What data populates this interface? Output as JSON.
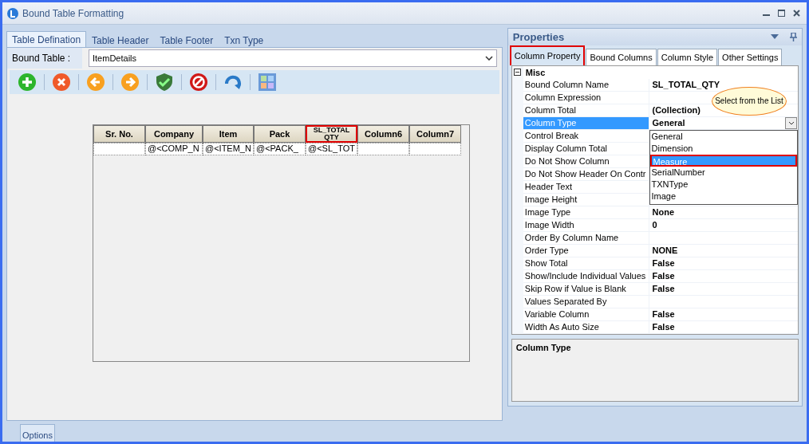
{
  "window": {
    "title": "Bound Table Formatting"
  },
  "tabs": [
    {
      "label": "Table Defination",
      "selected": true
    },
    {
      "label": "Table Header",
      "selected": false
    },
    {
      "label": "Table Footer",
      "selected": false
    },
    {
      "label": "Txn Type",
      "selected": false
    }
  ],
  "bound_table": {
    "label": "Bound Table :",
    "value": "ItemDetails"
  },
  "toolbar": [
    {
      "kind": "add"
    },
    {
      "kind": "delete"
    },
    {
      "kind": "back"
    },
    {
      "kind": "forward"
    },
    {
      "kind": "verify"
    },
    {
      "kind": "stop"
    },
    {
      "kind": "refresh"
    },
    {
      "kind": "layout"
    }
  ],
  "table": {
    "columns": [
      {
        "label": "Sr. No.",
        "highlighted": false
      },
      {
        "label": "Company",
        "highlighted": false
      },
      {
        "label": "Item",
        "highlighted": false
      },
      {
        "label": "Pack",
        "highlighted": false
      },
      {
        "label": "SL_TOTAL QTY",
        "highlighted": true
      },
      {
        "label": "Column6",
        "highlighted": false
      },
      {
        "label": "Column7",
        "highlighted": false
      }
    ],
    "rows": [
      [
        "",
        "@<COMP_N",
        "@<ITEM_N",
        "@<PACK_",
        "@<SL_TOT",
        "",
        ""
      ]
    ]
  },
  "properties": {
    "title": "Properties",
    "tabs": [
      {
        "label": "Column Property",
        "selected": true,
        "highlighted": true
      },
      {
        "label": "Bound Columns",
        "selected": false,
        "highlighted": false
      },
      {
        "label": "Column Style",
        "selected": false,
        "highlighted": false
      },
      {
        "label": "Other Settings",
        "selected": false,
        "highlighted": false
      }
    ],
    "category": {
      "label": "Misc",
      "expanded": true
    },
    "rows": [
      {
        "name": "Bound Column Name",
        "value": "SL_TOTAL_QTY",
        "selected": false
      },
      {
        "name": "Column Expression",
        "value": "",
        "selected": false
      },
      {
        "name": "Column Total",
        "value": "(Collection)",
        "selected": false
      },
      {
        "name": "Column Type",
        "value": "General",
        "selected": true
      },
      {
        "name": "Control Break",
        "value": "",
        "selected": false
      },
      {
        "name": "Display Column Total",
        "value": "",
        "selected": false
      },
      {
        "name": "Do Not Show Column",
        "value": "",
        "selected": false
      },
      {
        "name": "Do Not Show Header On Contr",
        "value": "",
        "selected": false
      },
      {
        "name": "Header Text",
        "value": "",
        "selected": false
      },
      {
        "name": "Image Height",
        "value": "",
        "selected": false
      },
      {
        "name": "Image Type",
        "value": "None",
        "selected": false
      },
      {
        "name": "Image Width",
        "value": "0",
        "selected": false
      },
      {
        "name": "Order By Column Name",
        "value": "",
        "selected": false
      },
      {
        "name": "Order Type",
        "value": "NONE",
        "selected": false
      },
      {
        "name": "Show Total",
        "value": "False",
        "selected": false
      },
      {
        "name": "Show/Include Individual Values",
        "value": "False",
        "selected": false
      },
      {
        "name": "Skip Row if Value is Blank",
        "value": "False",
        "selected": false
      },
      {
        "name": "Values Separated By",
        "value": "",
        "selected": false
      },
      {
        "name": "Variable Column",
        "value": "False",
        "selected": false
      },
      {
        "name": "Width As Auto Size",
        "value": "False",
        "selected": false
      }
    ],
    "dropdown": {
      "items": [
        {
          "label": "General",
          "selected": false,
          "highlighted": false
        },
        {
          "label": "Dimension",
          "selected": false,
          "highlighted": false
        },
        {
          "label": "Measure",
          "selected": true,
          "highlighted": true
        },
        {
          "label": "SerialNumber",
          "selected": false,
          "highlighted": false
        },
        {
          "label": "TXNType",
          "selected": false,
          "highlighted": false
        },
        {
          "label": "Image",
          "selected": false,
          "highlighted": false
        }
      ]
    },
    "callout": "Select from the List",
    "help_title": "Column Type"
  },
  "footer_tabs": [
    {
      "label": "Options",
      "selected": true
    }
  ]
}
